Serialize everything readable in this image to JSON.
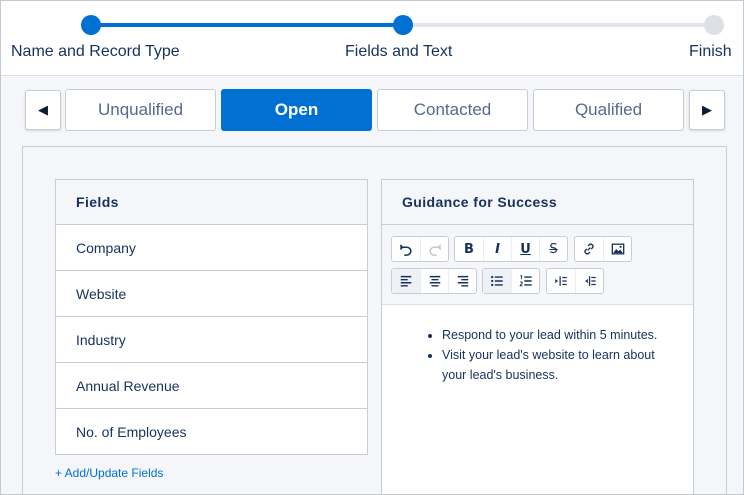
{
  "progress": {
    "steps": [
      {
        "label": "Name and Record Type",
        "state": "complete"
      },
      {
        "label": "Fields and Text",
        "state": "current"
      },
      {
        "label": "Finish",
        "state": "pending"
      }
    ]
  },
  "stage_tabs": {
    "prev_icon": "triangle-left-icon",
    "next_icon": "triangle-right-icon",
    "tabs": [
      "Unqualified",
      "Open",
      "Contacted",
      "Qualified"
    ],
    "selected": "Open"
  },
  "fields_panel": {
    "header": "Fields",
    "items": [
      "Company",
      "Website",
      "Industry",
      "Annual Revenue",
      "No. of Employees"
    ],
    "add_link": "+ Add/Update Fields"
  },
  "guidance_panel": {
    "header": "Guidance for Success",
    "toolbar_icons": [
      "undo-icon",
      "redo-icon",
      "bold-icon",
      "italic-icon",
      "underline-icon",
      "strikethrough-icon",
      "link-icon",
      "image-icon",
      "align-left-icon",
      "align-center-icon",
      "align-right-icon",
      "bulleted-list-icon",
      "numbered-list-icon",
      "indent-icon",
      "outdent-icon"
    ],
    "bold_glyph": "B",
    "italic_glyph": "I",
    "underline_glyph": "U",
    "strike_glyph": "S",
    "bullets": [
      "Respond to your lead within 5 minutes.",
      "Visit your lead's website to learn about your lead's business."
    ]
  },
  "colors": {
    "brand": "#0070d2",
    "text": "#16325c",
    "border": "#c8ccd3"
  }
}
